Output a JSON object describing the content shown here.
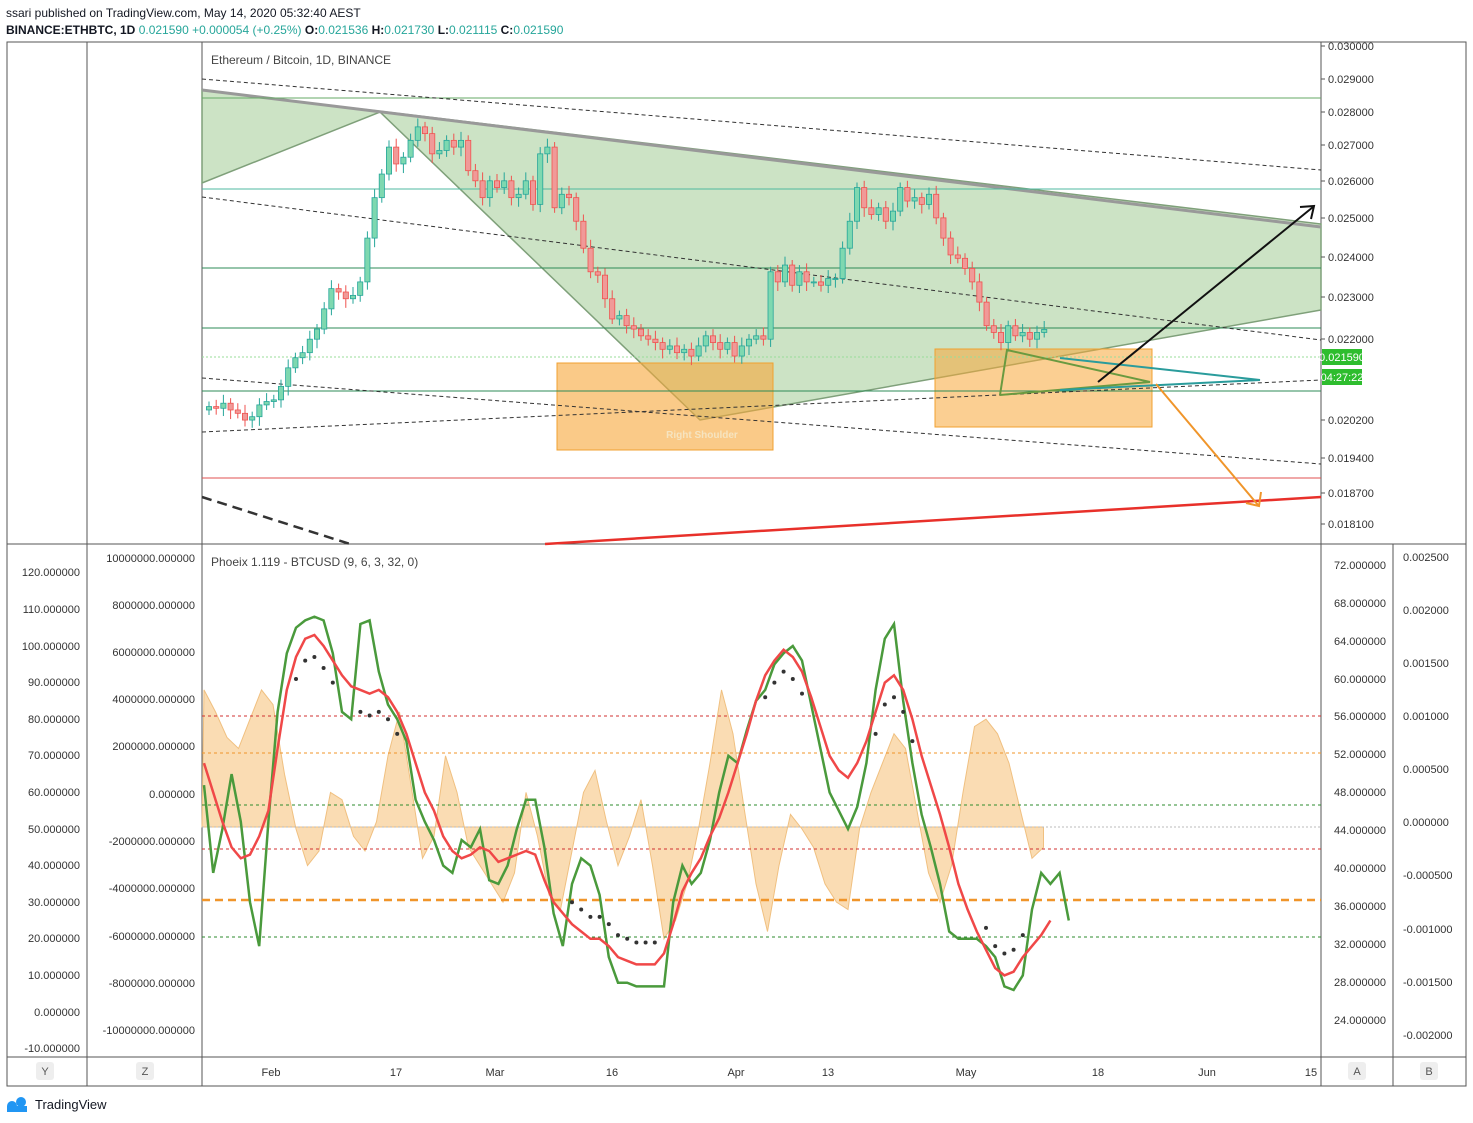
{
  "header": {
    "publish_line": "ssari published on TradingView.com, May 14, 2020 05:32:40 AEST",
    "symbol": "BINANCE:ETHBTC, 1D",
    "last": "0.021590",
    "change": "+0.000054 (+0.25%)",
    "o_label": "O:",
    "o": "0.021536",
    "h_label": "H:",
    "h": "0.021730",
    "l_label": "L:",
    "l": "0.021115",
    "c_label": "C:",
    "c": "0.021590"
  },
  "footer": {
    "brand": "TradingView"
  },
  "colors": {
    "up": "#26a69a",
    "down": "#ef5350",
    "green_fill": "#8fc27f",
    "orange_fill": "#f7a738",
    "price_tag": "#2ebd2e"
  },
  "chart_data": [
    {
      "type": "candlestick",
      "title": "Ethereum / Bitcoin, 1D, BINANCE",
      "ylim": [
        0.0179,
        0.0303
      ],
      "y_ticks": [
        "0.030000",
        "0.029000",
        "0.028000",
        "0.027000",
        "0.026000",
        "0.025000",
        "0.024000",
        "0.023000",
        "0.022000",
        "0.021590",
        "0.020200",
        "0.019400",
        "0.018700",
        "0.018100"
      ],
      "x_ticks": [
        "Feb",
        "17",
        "Mar",
        "16",
        "Apr",
        "13",
        "May",
        "18",
        "Jun",
        "15"
      ],
      "price_tag": "0.021590",
      "countdown_tag": "04:27:22",
      "annotations": [
        "Right Shoulder"
      ],
      "close": [
        0.0193,
        0.01925,
        0.0194,
        0.0192,
        0.0191,
        0.0189,
        0.019,
        0.01935,
        0.01945,
        0.0195,
        0.0199,
        0.02045,
        0.02075,
        0.0209,
        0.0213,
        0.0216,
        0.0222,
        0.0228,
        0.0227,
        0.0225,
        0.0226,
        0.023,
        0.0243,
        0.0255,
        0.0262,
        0.027,
        0.0265,
        0.0267,
        0.0272,
        0.0276,
        0.0274,
        0.0268,
        0.0269,
        0.0272,
        0.027,
        0.0272,
        0.0263,
        0.026,
        0.0255,
        0.026,
        0.0258,
        0.026,
        0.0255,
        0.0256,
        0.026,
        0.0253,
        0.0268,
        0.027,
        0.0252,
        0.0256,
        0.0255,
        0.0248,
        0.024,
        0.0233,
        0.0232,
        0.0225,
        0.0219,
        0.022,
        0.0217,
        0.0216,
        0.0214,
        0.0213,
        0.0212,
        0.021,
        0.0211,
        0.0209,
        0.021,
        0.0208,
        0.0211,
        0.0214,
        0.0212,
        0.021,
        0.0212,
        0.0208,
        0.0211,
        0.0213,
        0.0214,
        0.0213,
        0.0233,
        0.023,
        0.0235,
        0.0229,
        0.0233,
        0.023,
        0.023,
        0.0229,
        0.0231,
        0.0231,
        0.024,
        0.0248,
        0.0258,
        0.0252,
        0.025,
        0.0252,
        0.0248,
        0.0251,
        0.0258,
        0.0254,
        0.0255,
        0.0253,
        0.0256,
        0.0249,
        0.0243,
        0.0238,
        0.0237,
        0.0234,
        0.023,
        0.0224,
        0.0217,
        0.0215,
        0.0212,
        0.0217,
        0.0214,
        0.0215,
        0.0213,
        0.0215,
        0.02159
      ]
    },
    {
      "type": "line",
      "title": "Phoeix 1.119 - BTCUSD (9, 6, 3, 32, 0)",
      "left_ticks": [
        "120.000000",
        "110.000000",
        "100.000000",
        "90.000000",
        "80.000000",
        "70.000000",
        "60.000000",
        "50.000000",
        "40.000000",
        "30.000000",
        "20.000000",
        "10.000000",
        "0.000000",
        "-10.000000"
      ],
      "inner_ticks": [
        "10000000.000000",
        "8000000.000000",
        "6000000.000000",
        "4000000.000000",
        "2000000.000000",
        "0.000000",
        "-2000000.000000",
        "-4000000.000000",
        "-6000000.000000",
        "-8000000.000000",
        "-10000000.000000"
      ],
      "right_ticks": [
        "72.000000",
        "68.000000",
        "64.000000",
        "60.000000",
        "56.000000",
        "52.000000",
        "48.000000",
        "44.000000",
        "40.000000",
        "36.000000",
        "32.000000",
        "28.000000",
        "24.000000"
      ],
      "far_right_ticks": [
        "0.002500",
        "0.002000",
        "0.001500",
        "0.001000",
        "0.000500",
        "0.000000",
        "-0.000500",
        "-0.001000",
        "-0.001500",
        "-0.002000"
      ],
      "series": [
        {
          "values": [
            62,
            38,
            50,
            65,
            52,
            30,
            18,
            52,
            82,
            98,
            105,
            107,
            108,
            107,
            98,
            82,
            80,
            106,
            107,
            93,
            84,
            80,
            74,
            58,
            52,
            47,
            40,
            38,
            47,
            45,
            50,
            36,
            35,
            40,
            50,
            58,
            58,
            45,
            27,
            18,
            35,
            42,
            40,
            32,
            15,
            8,
            8,
            7,
            7,
            7,
            7,
            30,
            40,
            35,
            38,
            47,
            60,
            70,
            68,
            77,
            85,
            88,
            95,
            98,
            100,
            96,
            84,
            72,
            60,
            55,
            50,
            56,
            68,
            88,
            102,
            106,
            85,
            68,
            54,
            45,
            35,
            22,
            20,
            20,
            20,
            18,
            15,
            7,
            6,
            10,
            28,
            38,
            35,
            38,
            25
          ]
        },
        {
          "values": [
            68,
            60,
            52,
            45,
            42,
            43,
            48,
            55,
            72,
            88,
            97,
            102,
            103,
            100,
            96,
            92,
            89,
            88,
            87,
            88,
            86,
            82,
            76,
            68,
            60,
            55,
            48,
            44,
            42,
            43,
            45,
            44,
            41,
            42,
            43,
            44,
            43,
            36,
            30,
            27,
            24,
            22,
            20,
            20,
            18,
            15,
            14,
            13,
            13,
            13,
            16,
            24,
            33,
            38,
            42,
            48,
            53,
            60,
            68,
            76,
            85,
            92,
            96,
            99,
            97,
            93,
            86,
            78,
            70,
            66,
            64,
            68,
            74,
            82,
            90,
            92,
            88,
            80,
            70,
            62,
            54,
            45,
            35,
            28,
            22,
            17,
            12,
            10,
            11,
            15,
            18,
            21,
            25
          ]
        },
        {
          "values": [
            88,
            82,
            75,
            72,
            80,
            88,
            84,
            65,
            50,
            40,
            44,
            60,
            58,
            48,
            44,
            52,
            70,
            82,
            62,
            42,
            48,
            70,
            60,
            45,
            40,
            35,
            30,
            38,
            60,
            48,
            32,
            28,
            44,
            60,
            66,
            52,
            40,
            48,
            58,
            40,
            20,
            25,
            35,
            50,
            68,
            88,
            76,
            55,
            35,
            22,
            40,
            54,
            50,
            45,
            35,
            30,
            28,
            50,
            60,
            68,
            76,
            72,
            55,
            38,
            30,
            40,
            60,
            78,
            80,
            76,
            68,
            55,
            42,
            45
          ]
        }
      ]
    }
  ]
}
